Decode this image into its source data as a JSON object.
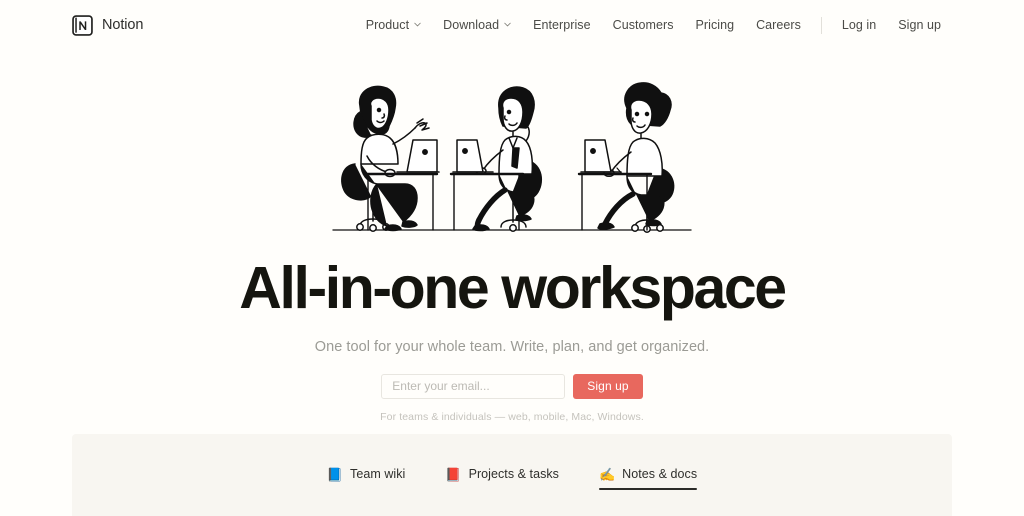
{
  "brand": {
    "name": "Notion",
    "logo_icon": "notion-n-logo"
  },
  "nav": {
    "items": [
      {
        "label": "Product",
        "has_dropdown": true,
        "icon": "chevron-down-icon"
      },
      {
        "label": "Download",
        "has_dropdown": true,
        "icon": "chevron-down-icon"
      },
      {
        "label": "Enterprise",
        "has_dropdown": false
      },
      {
        "label": "Customers",
        "has_dropdown": false
      },
      {
        "label": "Pricing",
        "has_dropdown": false
      },
      {
        "label": "Careers",
        "has_dropdown": false
      }
    ],
    "auth": [
      {
        "label": "Log in"
      },
      {
        "label": "Sign up"
      }
    ]
  },
  "hero": {
    "illustration_name": "three-people-at-desks-with-laptops-illustration",
    "headline": "All-in-one workspace",
    "subhead": "One tool for your whole team. Write, plan, and get organized.",
    "form": {
      "email_placeholder": "Enter your email...",
      "email_value": "",
      "submit_label": "Sign up"
    },
    "fineprint": "For teams & individuals — web, mobile, Mac, Windows."
  },
  "feature_tabs": {
    "items": [
      {
        "label": "Team wiki",
        "emoji": "📘",
        "icon": "blue-book-icon",
        "active": false
      },
      {
        "label": "Projects & tasks",
        "emoji": "📕",
        "icon": "red-book-icon",
        "active": false
      },
      {
        "label": "Notes & docs",
        "emoji": "✍️",
        "icon": "writing-hand-icon",
        "active": true
      }
    ]
  },
  "colors": {
    "page_background": "#fffefb",
    "panel_background": "#f8f6f1",
    "accent": "#e8685e",
    "text_primary": "#15150f",
    "text_muted": "#9b9b95"
  }
}
